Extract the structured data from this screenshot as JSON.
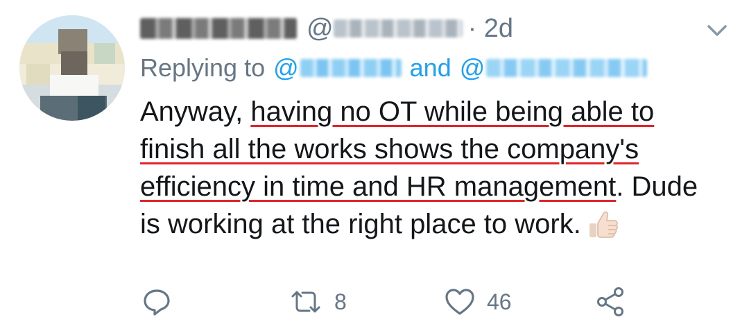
{
  "tweet": {
    "display_name_redacted": true,
    "handle_prefix": "@",
    "handle_redacted": true,
    "time_text": "· 2d",
    "replying": {
      "prefix": "Replying to",
      "at1": "@",
      "connector": "and",
      "at2": "@",
      "mentions_redacted": true
    },
    "text": {
      "line1_plain": "Anyway, ",
      "line1_underlined": "having no OT while being able to",
      "line2_underlined": "finish all the works shows the company's",
      "line3_underlined": "efficiency in time and HR management",
      "line3_plain": ". Dude",
      "line4_plain": "is working at the right place to work.",
      "emoji": "thumbs-up-light-skin-tone"
    },
    "actions": {
      "reply_icon": "reply-bubble-icon",
      "retweet_icon": "retweet-icon",
      "retweet_count": "8",
      "like_icon": "heart-icon",
      "like_count": "46",
      "share_icon": "share-icon"
    }
  },
  "colors": {
    "text": "#14171a",
    "secondary": "#657786",
    "link": "#1da1f2",
    "underline_annotation": "#e0242b"
  }
}
